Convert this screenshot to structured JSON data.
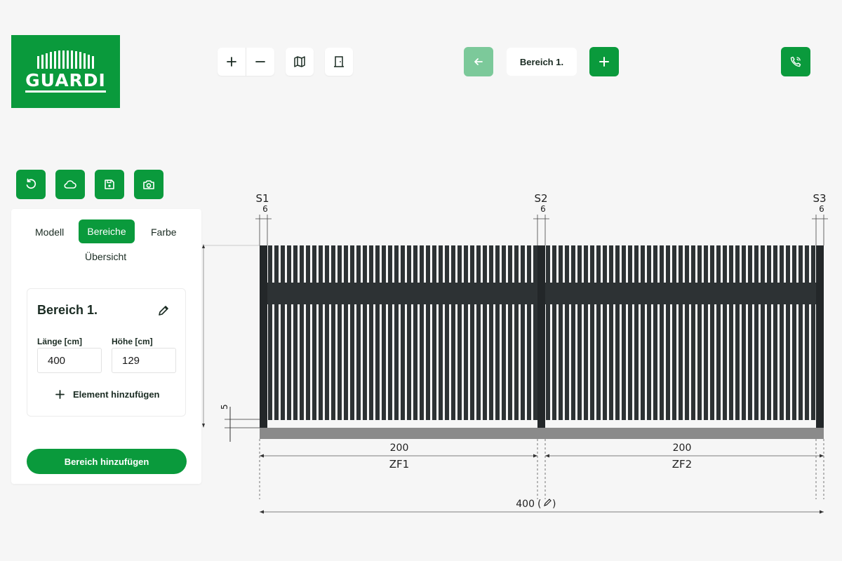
{
  "brand": {
    "name": "GUARDI",
    "color": "#0a9a3c"
  },
  "toolbar": {
    "zoom_in_icon": "plus-icon",
    "zoom_out_icon": "minus-icon",
    "map_icon": "map-icon",
    "door_icon": "door-icon"
  },
  "area_nav": {
    "back_icon": "arrow-left-icon",
    "current_area": "Bereich 1.",
    "add_icon": "plus-icon"
  },
  "contact": {
    "icon": "phone-call-icon"
  },
  "actions": {
    "icons": [
      "reset-icon",
      "cloud-icon",
      "save-icon",
      "camera-icon"
    ]
  },
  "panel": {
    "tabs": [
      {
        "label": "Modell",
        "active": false
      },
      {
        "label": "Bereiche",
        "active": true
      },
      {
        "label": "Farbe",
        "active": false
      },
      {
        "label": "Übersicht",
        "active": false
      }
    ],
    "card": {
      "title": "Bereich 1.",
      "length_label": "Länge [cm]",
      "length_value": "400",
      "height_label": "Höhe [cm]",
      "height_value": "129",
      "add_element_label": "Element hinzufügen"
    },
    "add_area_label": "Bereich hinzufügen"
  },
  "drawing": {
    "posts": [
      {
        "label": "S1",
        "width": "6"
      },
      {
        "label": "S2",
        "width": "6"
      },
      {
        "label": "S3",
        "width": "6"
      }
    ],
    "fields": [
      {
        "label": "ZF1",
        "length": "200"
      },
      {
        "label": "ZF2",
        "length": "200"
      }
    ],
    "ground_gap": "5",
    "total_length": "400",
    "colors": {
      "fence": "#2d3234",
      "ground": "#8a8a8a"
    }
  }
}
